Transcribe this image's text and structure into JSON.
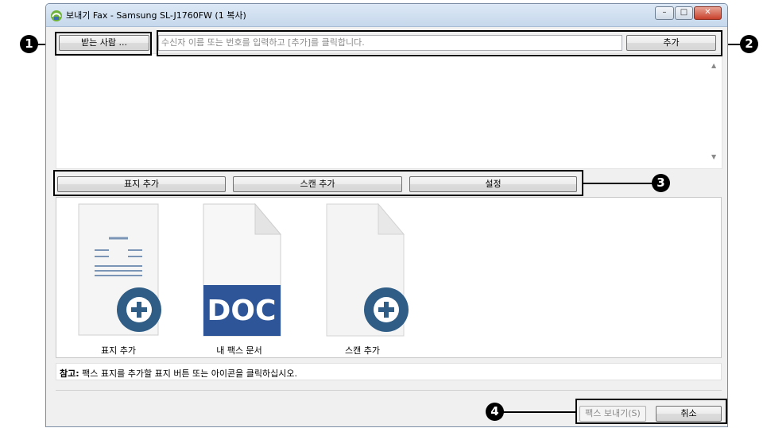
{
  "window": {
    "title": "보내기 Fax - Samsung SL-J1760FW (1 복사)",
    "controls": {
      "minimize": "–",
      "maximize": "□",
      "close": "✕"
    }
  },
  "recipient": {
    "button_label": "받는 사람 ...",
    "input_placeholder": "수신자 이름 또는 번호를 입력하고 [추가]를 클릭합니다.",
    "add_button_label": "추가"
  },
  "actions": {
    "add_cover_label": "표지 추가",
    "add_scan_label": "스캔 추가",
    "settings_label": "설정"
  },
  "documents": [
    {
      "label": "표지 추가",
      "icon": "cover-page-add-icon"
    },
    {
      "label": "내 팩스 문서",
      "icon": "doc-file-icon",
      "badge": "DOC"
    },
    {
      "label": "스캔 추가",
      "icon": "scan-page-add-icon"
    }
  ],
  "note": {
    "prefix": "참고:",
    "text": " 팩스 표지를 추가할 표지 버튼 또는 아이콘을 클릭하십시오."
  },
  "footer": {
    "send_label": "팩스 보내기(S)",
    "cancel_label": "취소"
  },
  "callouts": [
    "❶",
    "❷",
    "❸",
    "❹"
  ],
  "colors": {
    "doc_badge": "#2e5597",
    "plus_circle": "#2f5d86"
  }
}
